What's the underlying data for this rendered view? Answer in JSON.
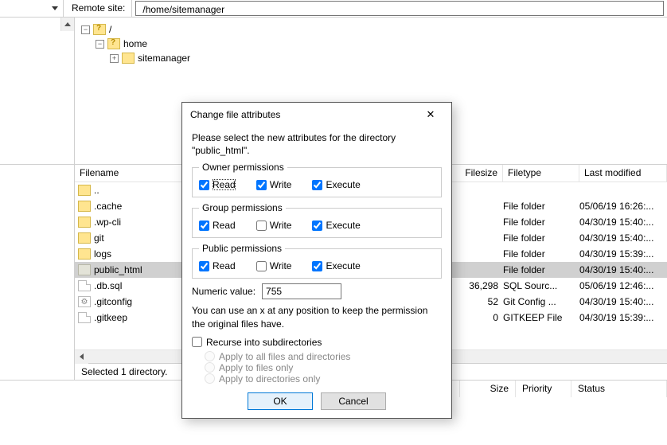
{
  "topbar": {
    "label": "Remote site:",
    "path": "/home/sitemanager"
  },
  "tree": {
    "root": "/",
    "home": "home",
    "sitemanager": "sitemanager"
  },
  "columns": {
    "name": "Filename",
    "size": "Filesize",
    "type": "Filetype",
    "modified": "Last modified"
  },
  "files": [
    {
      "name": "..",
      "icon": "folder",
      "size": "",
      "type": "",
      "modified": ""
    },
    {
      "name": ".cache",
      "icon": "folder",
      "size": "",
      "type": "File folder",
      "modified": "05/06/19 16:26:..."
    },
    {
      "name": ".wp-cli",
      "icon": "folder",
      "size": "",
      "type": "File folder",
      "modified": "04/30/19 15:40:..."
    },
    {
      "name": "git",
      "icon": "folder",
      "size": "",
      "type": "File folder",
      "modified": "04/30/19 15:40:..."
    },
    {
      "name": "logs",
      "icon": "folder",
      "size": "",
      "type": "File folder",
      "modified": "04/30/19 15:39:..."
    },
    {
      "name": "public_html",
      "icon": "folder-muted",
      "size": "",
      "type": "File folder",
      "modified": "04/30/19 15:40:...",
      "selected": true
    },
    {
      "name": ".db.sql",
      "icon": "file",
      "size": "36,298",
      "type": "SQL Sourc...",
      "modified": "05/06/19 12:46:..."
    },
    {
      "name": ".gitconfig",
      "icon": "gear",
      "size": "52",
      "type": "Git Config ...",
      "modified": "04/30/19 15:40:..."
    },
    {
      "name": ".gitkeep",
      "icon": "file",
      "size": "0",
      "type": "GITKEEP File",
      "modified": "04/30/19 15:39:..."
    }
  ],
  "status": "Selected 1 directory.",
  "queue": {
    "size": "Size",
    "priority": "Priority",
    "status": "Status"
  },
  "dialog": {
    "title": "Change file attributes",
    "intro": "Please select the new attributes for the directory \"public_html\".",
    "groups": {
      "owner": {
        "legend": "Owner permissions",
        "read": true,
        "write": true,
        "execute": true
      },
      "group": {
        "legend": "Group permissions",
        "read": true,
        "write": false,
        "execute": true
      },
      "public": {
        "legend": "Public permissions",
        "read": true,
        "write": false,
        "execute": true
      }
    },
    "labels": {
      "read": "Read",
      "write": "Write",
      "execute": "Execute"
    },
    "numeric_label": "Numeric value:",
    "numeric_value": "755",
    "hint": "You can use an x at any position to keep the permission the original files have.",
    "recurse_label": "Recurse into subdirectories",
    "recurse_checked": false,
    "radios": {
      "all": "Apply to all files and directories",
      "files": "Apply to files only",
      "dirs": "Apply to directories only"
    },
    "ok": "OK",
    "cancel": "Cancel"
  }
}
